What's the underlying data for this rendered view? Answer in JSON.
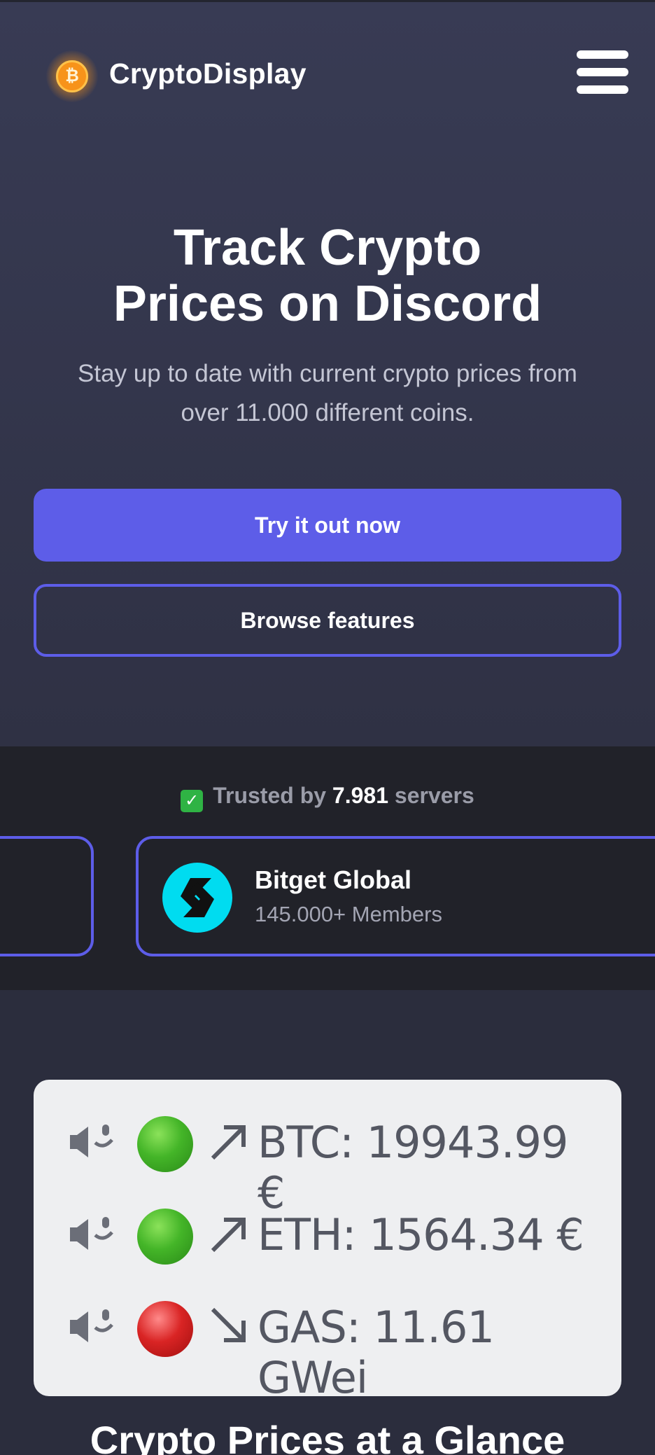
{
  "header": {
    "brand": "CryptoDisplay",
    "coin_glyph": "₿",
    "logo_icon": "bitcoin-logo-icon",
    "menu_icon": "hamburger-menu-icon"
  },
  "hero": {
    "title_line1": "Track Crypto",
    "title_line2": "Prices on Discord",
    "subtitle_line1": "Stay up to date with current crypto prices from",
    "subtitle_line2": "over 11.000 different coins.",
    "primary_button": "Try it out now",
    "secondary_button": "Browse features"
  },
  "trusted": {
    "check_glyph": "✓",
    "prefix": "Trusted by",
    "count": "7.981",
    "suffix": "servers",
    "servers": [
      {
        "name": "Bitget Global",
        "members": "145.000+ Members",
        "icon": "bitget-logo-icon"
      }
    ]
  },
  "preview": {
    "rows": [
      {
        "text": "BTC: 19943.99 €",
        "status": "green",
        "trend": "up"
      },
      {
        "text": "ETH: 1564.34 €",
        "status": "green",
        "trend": "up"
      },
      {
        "text": "GAS: 11.61 GWei",
        "status": "red",
        "trend": "down"
      }
    ]
  },
  "section": {
    "title": "Crypto Prices at a Glance"
  },
  "colors": {
    "accent": "#5d5de8",
    "background": "#2b2d3d",
    "dark_band": "#212229",
    "bitcoin": "#f7931a",
    "bitget": "#00dcf0"
  }
}
